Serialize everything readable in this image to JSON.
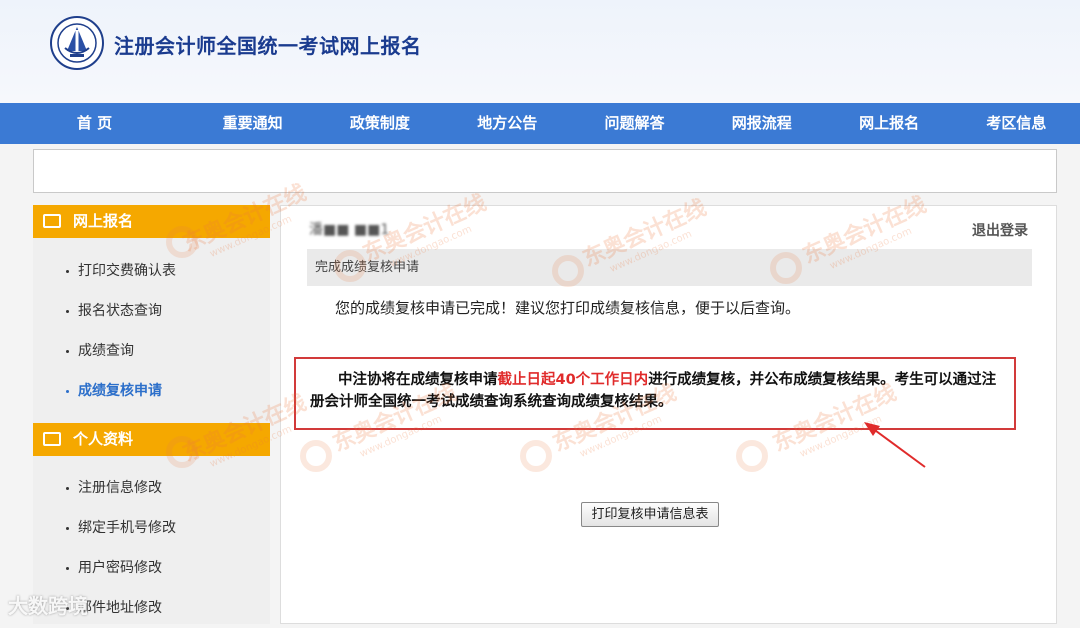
{
  "header": {
    "site_title": "注册会计师全国统一考试网上报名",
    "logo_icon": "cicpa-emblem-icon"
  },
  "nav": {
    "items": [
      {
        "label": "首 页"
      },
      {
        "label": "重要通知"
      },
      {
        "label": "政策制度"
      },
      {
        "label": "地方公告"
      },
      {
        "label": "问题解答"
      },
      {
        "label": "网报流程"
      },
      {
        "label": "网上报名"
      },
      {
        "label": "考区信息"
      }
    ]
  },
  "sidebar": {
    "section1": {
      "title": "网上报名",
      "items": [
        {
          "label": "打印交费确认表"
        },
        {
          "label": "报名状态查询"
        },
        {
          "label": "成绩查询"
        },
        {
          "label": "成绩复核申请"
        }
      ]
    },
    "section2": {
      "title": "个人资料",
      "items": [
        {
          "label": "注册信息修改"
        },
        {
          "label": "绑定手机号修改"
        },
        {
          "label": "用户密码修改"
        },
        {
          "label": "邮件地址修改"
        }
      ]
    }
  },
  "main": {
    "user_name": "潘■■ ■■1",
    "logout": "退出登录",
    "section_title": "完成成绩复核申请",
    "message": "您的成绩复核申请已完成！建议您打印成绩复核信息，便于以后查询。",
    "notice": {
      "part1": "中注协将在成绩复核申请",
      "part2_red": "截止日起40个工作日内",
      "part3": "进行成绩复核，并公布成绩复核结果。考生可以通过注册会计师全国统一考试成绩查询系统查询成绩复核结果。"
    },
    "print_button": "打印复核申请信息表"
  },
  "watermark": {
    "text": "东奥会计在线",
    "url": "www.dongao.com"
  },
  "corner_text": "大数跨境",
  "colors": {
    "nav_bg": "#3b7ad4",
    "sidebar_header": "#f5a800",
    "active_link": "#2c6fca",
    "notice_border": "#d23a3a",
    "notice_red": "#e02b2b"
  }
}
